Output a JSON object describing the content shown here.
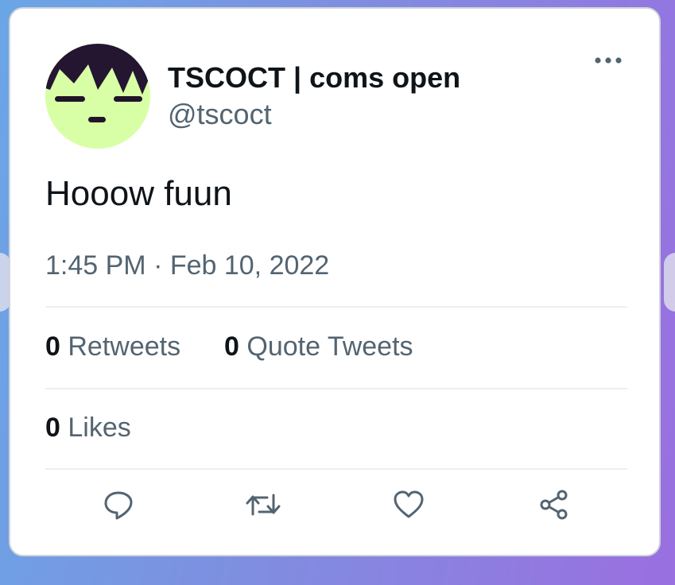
{
  "tweet": {
    "display_name": "TSCOCT | coms open",
    "handle": "@tscoct",
    "text": "Hooow fuun",
    "timestamp": "1:45 PM · Feb 10, 2022",
    "avatar_icon": "cartoon-face-avatar",
    "more_icon": "more-options-icon"
  },
  "stats": {
    "retweets": {
      "count": "0",
      "label": "Retweets"
    },
    "quote_tweets": {
      "count": "0",
      "label": "Quote Tweets"
    },
    "likes": {
      "count": "0",
      "label": "Likes"
    }
  },
  "actions": [
    {
      "icon": "reply-icon"
    },
    {
      "icon": "retweet-icon"
    },
    {
      "icon": "like-icon"
    },
    {
      "icon": "share-icon"
    }
  ],
  "colors": {
    "text_primary": "#0f1419",
    "text_secondary": "#536471",
    "divider": "#eceff1",
    "avatar_background": "#d9ffa6",
    "card_background": "#ffffff"
  }
}
